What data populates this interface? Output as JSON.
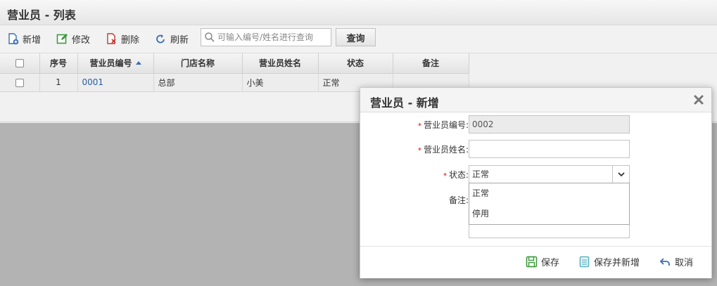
{
  "page": {
    "title": "营业员 - 列表"
  },
  "toolbar": {
    "add_label": "新增",
    "edit_label": "修改",
    "delete_label": "删除",
    "refresh_label": "刷新",
    "search_placeholder": "可输入编号/姓名进行查询",
    "search_value": "",
    "query_label": "查询"
  },
  "grid": {
    "columns": [
      "序号",
      "营业员编号",
      "门店名称",
      "营业员姓名",
      "状态",
      "备注"
    ],
    "rows": [
      {
        "index": "1",
        "code": "0001",
        "store": "总部",
        "name": "小美",
        "status": "正常",
        "remark": ""
      }
    ]
  },
  "dialog": {
    "title": "营业员 - 新增",
    "fields": {
      "code_label": "营业员编号:",
      "code_value": "0002",
      "name_label": "营业员姓名:",
      "name_value": "",
      "status_label": "状态:",
      "status_value": "正常",
      "remark_label": "备注:",
      "remark_value": ""
    },
    "status_options": [
      "正常",
      "停用"
    ],
    "required_mark": "*",
    "buttons": {
      "save": "保存",
      "save_new": "保存并新增",
      "cancel": "取消"
    }
  }
}
